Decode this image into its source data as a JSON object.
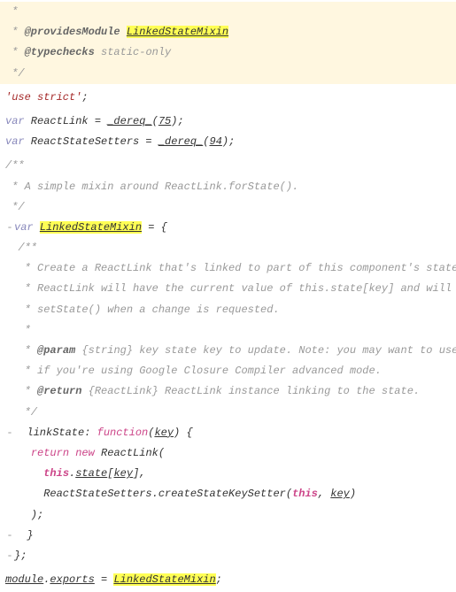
{
  "lines": {
    "l1": " *",
    "l2_pre": " * ",
    "l2_tag": "@providesModule",
    "l2_sp": " ",
    "l2_hl": "LinkedStateMixin",
    "l3_pre": " * ",
    "l3_tag": "@typechecks",
    "l3_rest": " static-only",
    "l4": " */",
    "l5": "",
    "l6": "'use strict'",
    "l6_semi": ";",
    "l7": "",
    "l8_var": "var",
    "l8_mid": " ReactLink = ",
    "l8_dereq": "_dereq_",
    "l8_paren1": "(",
    "l8_num": "75",
    "l8_paren2": ");",
    "l9_var": "var",
    "l9_mid": " ReactStateSetters = ",
    "l9_dereq": "_dereq_",
    "l9_paren1": "(",
    "l9_num": "94",
    "l9_paren2": ");",
    "l10": "",
    "l11": "/**",
    "l12": " * A simple mixin around ReactLink.forState().",
    "l13": " */",
    "l14_var": "var",
    "l14_sp": " ",
    "l14_hl": "LinkedStateMixin",
    "l14_eq": " = {",
    "l15": "  /**",
    "l16": "   * Create a ReactLink that's linked to part of this component's state. The",
    "l17": "   * ReactLink will have the current value of this.state[key] and will call",
    "l18": "   * setState() when a change is requested.",
    "l19": "   *",
    "l20_pre": "   * ",
    "l20_tag": "@param",
    "l20_rest": " {string} key state key to update. Note: you may want to use keyOf()",
    "l21": "   * if you're using Google Closure Compiler advanced mode.",
    "l22_pre": "   * ",
    "l22_tag": "@return",
    "l22_rest": " {ReactLink} ReactLink instance linking to the state.",
    "l23": "   */",
    "l24_pre": "  linkState: ",
    "l24_fn": "function",
    "l24_paren1": "(",
    "l24_key": "key",
    "l24_paren2": ") {",
    "l25_pre": "    ",
    "l25_ret": "return",
    "l25_sp": " ",
    "l25_new": "new",
    "l25_rest": " ReactLink(",
    "l26_pre": "      ",
    "l26_this": "this",
    "l26_dot": ".",
    "l26_state": "state",
    "l26_br1": "[",
    "l26_key": "key",
    "l26_br2": "],",
    "l27_pre": "      ReactStateSetters.createStateKeySetter(",
    "l27_this": "this",
    "l27_c": ", ",
    "l27_key": "key",
    "l27_end": ")",
    "l28": "    );",
    "l29": "  }",
    "l30": "};",
    "l31": "",
    "l32_mod": "module",
    "l32_dot": ".",
    "l32_exp": "exports",
    "l32_eq": " = ",
    "l32_hl": "LinkedStateMixin",
    "l32_semi": ";"
  }
}
